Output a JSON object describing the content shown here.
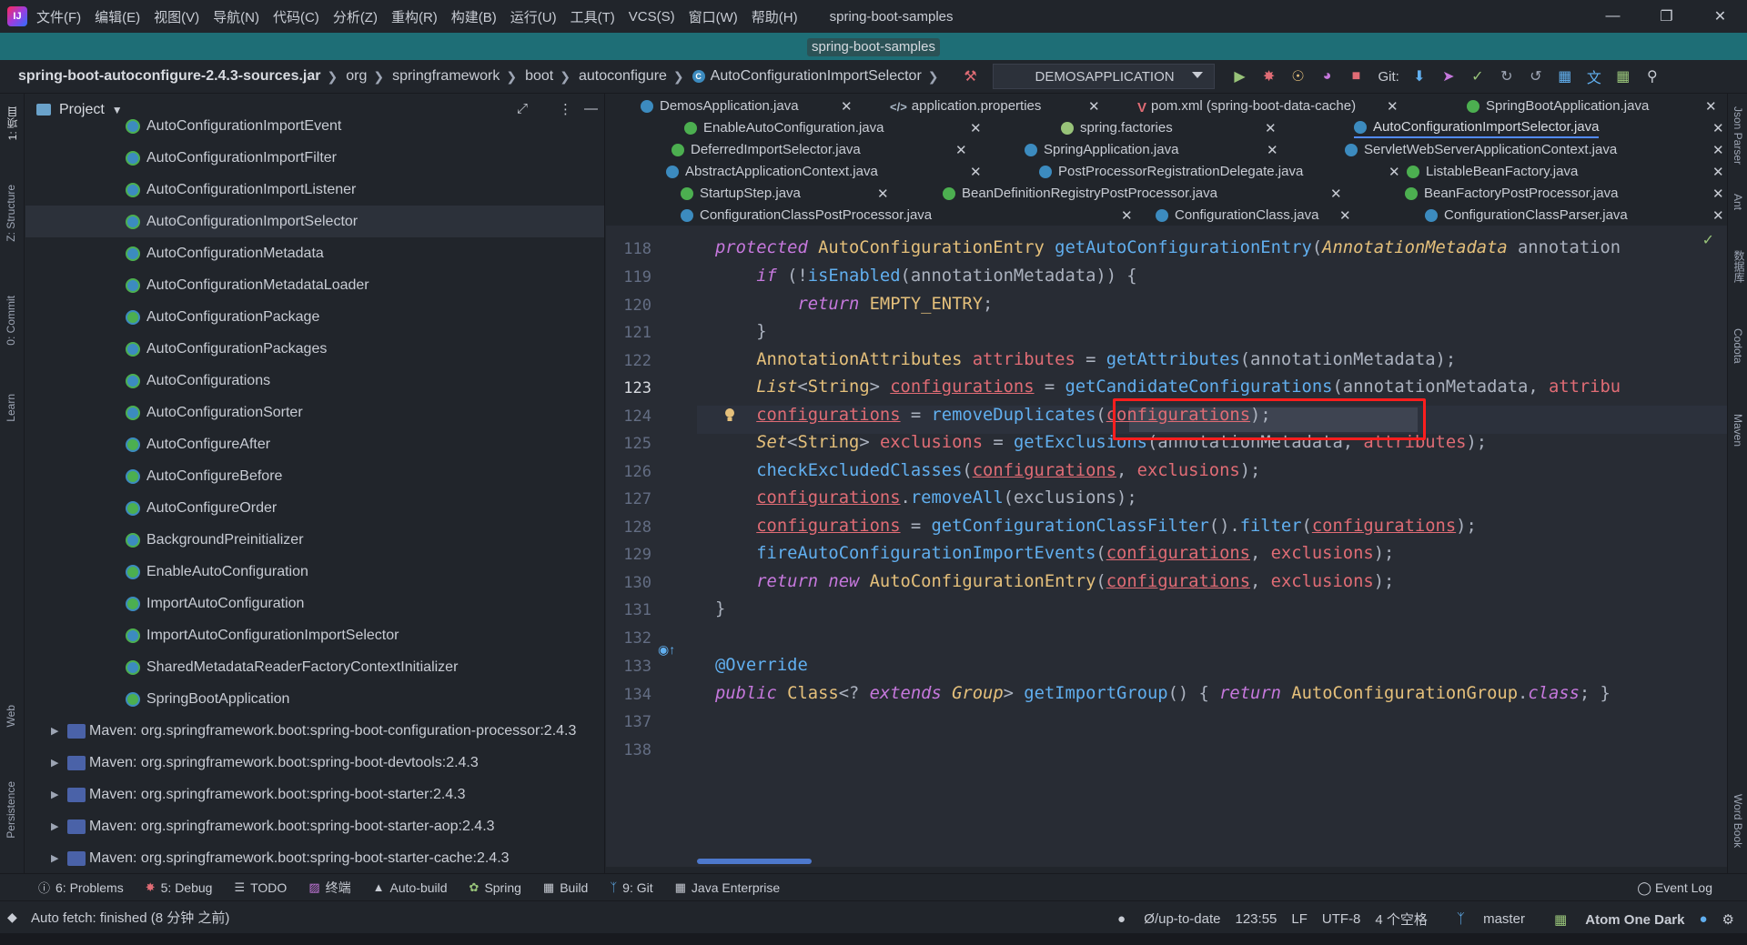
{
  "menu": {
    "items": [
      "文件(F)",
      "编辑(E)",
      "视图(V)",
      "导航(N)",
      "代码(C)",
      "分析(Z)",
      "重构(R)",
      "构建(B)",
      "运行(U)",
      "工具(T)",
      "VCS(S)",
      "窗口(W)",
      "帮助(H)"
    ],
    "window_title": "spring-boot-samples"
  },
  "project_tag": "spring-boot-samples",
  "breadcrumb": [
    "spring-boot-autoconfigure-2.4.3-sources.jar",
    "org",
    "springframework",
    "boot",
    "autoconfigure",
    "AutoConfigurationImportSelector"
  ],
  "run_config": "DEMOSAPPLICATION",
  "git_label": "Git:",
  "project_panel": {
    "title": "Project",
    "classes": [
      "AutoConfigurationImportEvent",
      "AutoConfigurationImportFilter",
      "AutoConfigurationImportListener",
      "AutoConfigurationImportSelector",
      "AutoConfigurationMetadata",
      "AutoConfigurationMetadataLoader",
      "AutoConfigurationPackage",
      "AutoConfigurationPackages",
      "AutoConfigurations",
      "AutoConfigurationSorter",
      "AutoConfigureAfter",
      "AutoConfigureBefore",
      "AutoConfigureOrder",
      "BackgroundPreinitializer",
      "EnableAutoConfiguration",
      "ImportAutoConfiguration",
      "ImportAutoConfigurationImportSelector",
      "SharedMetadataReaderFactoryContextInitializer",
      "SpringBootApplication"
    ],
    "selected": "AutoConfigurationImportSelector",
    "libraries": [
      "Maven: org.springframework.boot:spring-boot-configuration-processor:2.4.3",
      "Maven: org.springframework.boot:spring-boot-devtools:2.4.3",
      "Maven: org.springframework.boot:spring-boot-starter:2.4.3",
      "Maven: org.springframework.boot:spring-boot-starter-aop:2.4.3",
      "Maven: org.springframework.boot:spring-boot-starter-cache:2.4.3"
    ]
  },
  "tabs": [
    {
      "label": "DemosApplication.java",
      "icon": "class"
    },
    {
      "label": "application.properties",
      "icon": "properties"
    },
    {
      "label": "pom.xml (spring-boot-data-cache)",
      "icon": "maven"
    },
    {
      "label": "SpringBootApplication.java",
      "icon": "annotation"
    },
    {
      "label": "EnableAutoConfiguration.java",
      "icon": "annotation"
    },
    {
      "label": "spring.factories",
      "icon": "file"
    },
    {
      "label": "AutoConfigurationImportSelector.java",
      "icon": "class",
      "active": true
    },
    {
      "label": "DeferredImportSelector.java",
      "icon": "interface"
    },
    {
      "label": "SpringApplication.java",
      "icon": "class"
    },
    {
      "label": "ServletWebServerApplicationContext.java",
      "icon": "class"
    },
    {
      "label": "AbstractApplicationContext.java",
      "icon": "class"
    },
    {
      "label": "PostProcessorRegistrationDelegate.java",
      "icon": "class"
    },
    {
      "label": "ListableBeanFactory.java",
      "icon": "interface"
    },
    {
      "label": "StartupStep.java",
      "icon": "interface"
    },
    {
      "label": "BeanDefinitionRegistryPostProcessor.java",
      "icon": "interface"
    },
    {
      "label": "BeanFactoryPostProcessor.java",
      "icon": "interface"
    },
    {
      "label": "ConfigurationClassPostProcessor.java",
      "icon": "class"
    },
    {
      "label": "ConfigurationClass.java",
      "icon": "class"
    },
    {
      "label": "ConfigurationClassParser.java",
      "icon": "class"
    }
  ],
  "editor": {
    "line_numbers": [
      "118",
      "119",
      "120",
      "121",
      "122",
      "123",
      "124",
      "125",
      "126",
      "127",
      "128",
      "129",
      "130",
      "131",
      "132",
      "133",
      "134",
      "137",
      "138"
    ],
    "current_line": "123",
    "highlighted_call": "getCandidateConfigurations"
  },
  "bottom_tools": [
    "6: Problems",
    "5: Debug",
    "TODO",
    "终端",
    "Auto-build",
    "Spring",
    "Build",
    "9: Git",
    "Java Enterprise"
  ],
  "event_log": "Event Log",
  "left_strip": [
    "1: 项目",
    "Z: Structure",
    "0: Commit",
    "Learn",
    "Web",
    "Persistence"
  ],
  "right_strip": [
    "Json Parser",
    "Ant",
    "数据库",
    "Codota",
    "Maven",
    "Word Book"
  ],
  "status": {
    "message": "Auto fetch: finished (8 分钟 之前)",
    "vcs": "Ø/up-to-date",
    "position": "123:55",
    "line_sep": "LF",
    "encoding": "UTF-8",
    "indent": "4 个空格",
    "branch": "master",
    "theme": "Atom One Dark"
  },
  "colors": {
    "background": "#282c34",
    "panel": "#21252b",
    "project_strip": "#1e6e76",
    "keyword": "#c678dd",
    "type": "#e5c07b",
    "function": "#61afef",
    "variable": "#e06c75",
    "highlight_box": "#ff1e1e"
  }
}
